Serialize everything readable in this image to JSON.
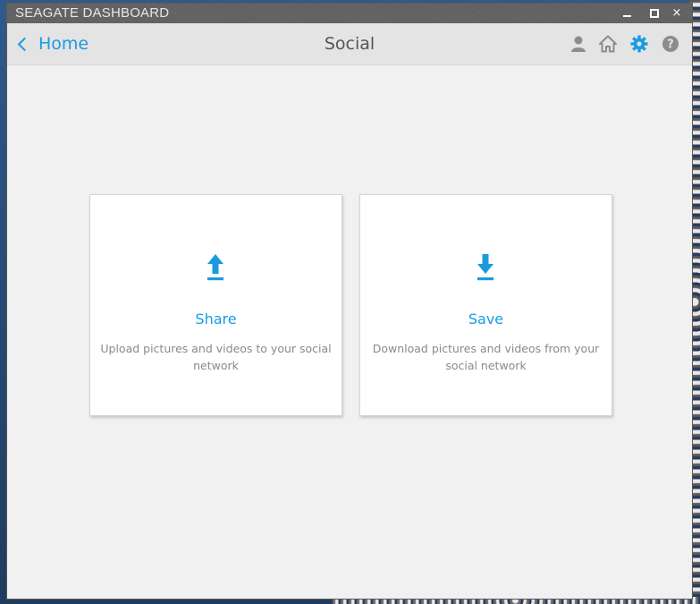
{
  "window": {
    "title": "SEAGATE DASHBOARD",
    "minimize_label": "",
    "maximize_label": "",
    "close_label": "×"
  },
  "header": {
    "back_label": "Home",
    "title": "Social",
    "icons": [
      "user-icon",
      "home-icon",
      "gear-icon",
      "help-icon"
    ]
  },
  "cards": [
    {
      "title": "Share",
      "description": "Upload pictures and videos to your social network",
      "icon": "upload-icon"
    },
    {
      "title": "Save",
      "description": "Download pictures and videos from your social network",
      "icon": "download-icon"
    }
  ],
  "colors": {
    "accent": "#1a9be0",
    "icon_gray": "#8c8c8c",
    "background": "#f1f1f1"
  }
}
